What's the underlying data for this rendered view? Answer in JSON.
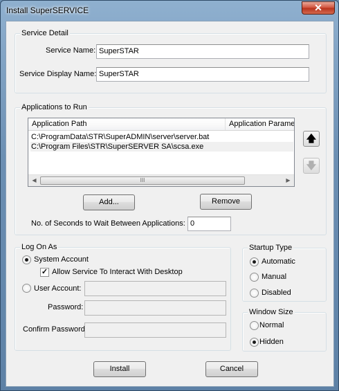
{
  "window": {
    "title": "Install SuperSERVICE",
    "close_glyph": "✕"
  },
  "service_detail": {
    "group_label": "Service Detail",
    "service_name_label": "Service Name:",
    "service_name_value": "SuperSTAR",
    "display_name_label": "Service Display Name:",
    "display_name_value": "SuperSTAR"
  },
  "applications": {
    "group_label": "Applications to Run",
    "columns": [
      "Application Path",
      "Application Parame"
    ],
    "rows": [
      "C:\\ProgramData\\STR\\SuperADMIN\\server\\server.bat",
      "C:\\Program Files\\STR\\SuperSERVER SA\\scsa.exe"
    ],
    "scroll_left": "◀",
    "scroll_right": "▶",
    "scroll_grip": "III",
    "move_up_glyph": "🡅",
    "move_down_glyph": "🡇",
    "add_label": "Add...",
    "remove_label": "Remove",
    "wait_label": "No. of Seconds to Wait Between Applications:",
    "wait_value": "0"
  },
  "logon": {
    "group_label": "Log On As",
    "system_account_label": "System Account",
    "system_account_selected": true,
    "interact_label": "Allow Service To Interact With Desktop",
    "interact_checked": true,
    "check_glyph": "✓",
    "user_account_label": "User Account:",
    "user_account_value": "",
    "password_label": "Password:",
    "password_value": "",
    "confirm_label": "Confirm Password:",
    "confirm_value": ""
  },
  "startup": {
    "group_label": "Startup Type",
    "options": [
      "Automatic",
      "Manual",
      "Disabled"
    ],
    "selected": "Automatic"
  },
  "window_size": {
    "group_label": "Window Size",
    "options": [
      "Normal",
      "Hidden"
    ],
    "selected": "Hidden"
  },
  "footer": {
    "install_label": "Install",
    "cancel_label": "Cancel"
  },
  "colors": {
    "titlebar_accent": "#6c8fb3",
    "close_button": "#c8452d",
    "dialog_bg": "#f0f0f0"
  }
}
